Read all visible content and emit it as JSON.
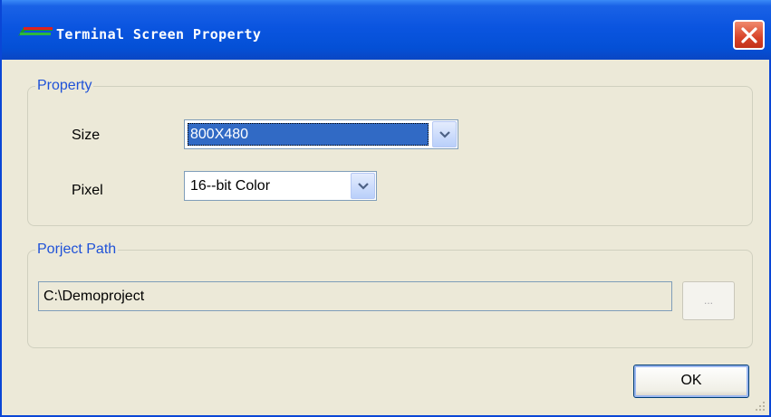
{
  "window": {
    "title": "Terminal Screen Property"
  },
  "property_group": {
    "legend": "Property",
    "size": {
      "label": "Size",
      "value": "800X480"
    },
    "pixel": {
      "label": "Pixel",
      "value": "16--bit Color"
    }
  },
  "path_group": {
    "legend": "Porject Path",
    "path_value": "C:\\Demoproject",
    "browse_label": "..."
  },
  "buttons": {
    "ok_label": "OK"
  },
  "colors": {
    "titlebar": "#0450d6",
    "legend_text": "#1f52d8",
    "selection": "#316ac5",
    "dialog_bg": "#ece9d8",
    "close_button": "#d8442a"
  },
  "icons": [
    "app-icon",
    "close-icon",
    "chevron-down-icon",
    "resize-grip-icon"
  ]
}
